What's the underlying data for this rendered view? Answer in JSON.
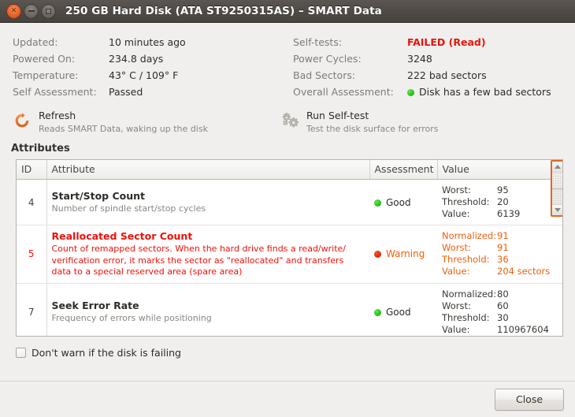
{
  "window": {
    "title": "250 GB Hard Disk (ATA ST9250315AS) – SMART Data",
    "close_glyph": "✕",
    "minimize_name": "minimize-button",
    "maximize_name": "maximize-button"
  },
  "summary": {
    "left": [
      {
        "label": "Updated:",
        "value": "10 minutes ago"
      },
      {
        "label": "Powered On:",
        "value": "234.8 days"
      },
      {
        "label": "Temperature:",
        "value": "43° C / 109° F"
      },
      {
        "label": "Self Assessment:",
        "value": "Passed"
      }
    ],
    "right": [
      {
        "label": "Self-tests:",
        "value": "FAILED (Read)",
        "state": "failed"
      },
      {
        "label": "Power Cycles:",
        "value": "3248",
        "state": "normal"
      },
      {
        "label": "Bad Sectors:",
        "value": "222 bad sectors",
        "state": "normal"
      },
      {
        "label": "Overall Assessment:",
        "value": "Disk has a few bad sectors",
        "state": "dot-green"
      }
    ]
  },
  "actions": {
    "refresh": {
      "icon": "refresh-icon",
      "title": "Refresh",
      "subtitle": "Reads SMART Data, waking up the disk"
    },
    "selftest": {
      "icon": "gears-icon",
      "title": "Run Self-test",
      "subtitle": "Test the disk surface for errors"
    }
  },
  "attributes_section": {
    "heading": "Attributes",
    "columns": [
      "ID",
      "Attribute",
      "Assessment",
      "Value"
    ],
    "rows": [
      {
        "id": "4",
        "name": "Start/Stop Count",
        "desc": "Number of spindle start/stop cycles",
        "assessment": "Good",
        "assessment_state": "good",
        "values": [
          {
            "key": "Worst:",
            "val": "95"
          },
          {
            "key": "Threshold:",
            "val": "20"
          },
          {
            "key": "Value:",
            "val": "6139"
          }
        ]
      },
      {
        "id": "5",
        "name": "Reallocated Sector Count",
        "desc": "Count of remapped sectors. When the hard drive finds a read/write/ verification error, it marks the sector as \"reallocated\" and transfers data to a special reserved area (spare area)",
        "assessment": "Warning",
        "assessment_state": "warning",
        "values": [
          {
            "key": "Normalized:",
            "val": "91"
          },
          {
            "key": "Worst:",
            "val": "91"
          },
          {
            "key": "Threshold:",
            "val": "36"
          },
          {
            "key": "Value:",
            "val": "204 sectors"
          }
        ]
      },
      {
        "id": "7",
        "name": "Seek Error Rate",
        "desc": "Frequency of errors while positioning",
        "assessment": "Good",
        "assessment_state": "good",
        "values": [
          {
            "key": "Normalized:",
            "val": "80"
          },
          {
            "key": "Worst:",
            "val": "60"
          },
          {
            "key": "Threshold:",
            "val": "30"
          },
          {
            "key": "Value:",
            "val": "110967604"
          }
        ]
      }
    ]
  },
  "options": {
    "dont_warn_label": "Don't warn if the disk is failing",
    "dont_warn_checked": false
  },
  "footer": {
    "close_label": "Close"
  },
  "colors": {
    "titlebar": "#504b47",
    "accent_orange": "#e8651f",
    "fail_red": "#e8140c",
    "warn_orange": "#f0600c",
    "good_green": "#22c512",
    "background": "#f0efee"
  }
}
